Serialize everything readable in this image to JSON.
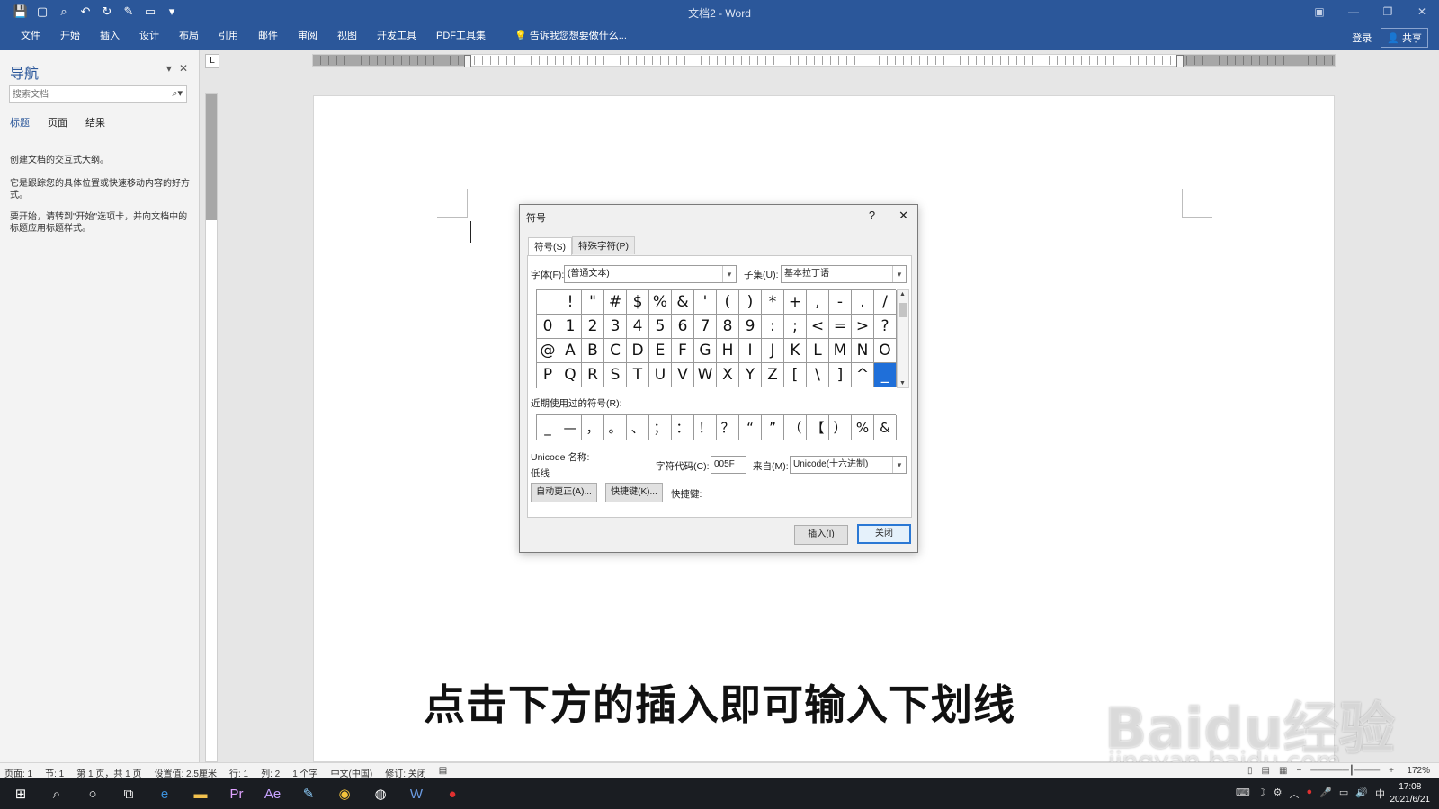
{
  "titlebar": {
    "title": "文档2 - Word",
    "qat_icons": [
      "save-icon",
      "new-document-icon",
      "print-preview-icon",
      "undo-icon",
      "redo-icon",
      "edit-icon",
      "open-icon",
      "customize-icon"
    ]
  },
  "ribbon": {
    "tabs": [
      "文件",
      "开始",
      "插入",
      "设计",
      "布局",
      "引用",
      "邮件",
      "审阅",
      "视图",
      "开发工具",
      "PDF工具集"
    ],
    "tell_me": "告诉我您想要做什么...",
    "login": "登录",
    "share": "共享"
  },
  "nav": {
    "title": "导航",
    "search_placeholder": "搜索文档",
    "tabs": [
      "标题",
      "页面",
      "结果"
    ],
    "hint1": "创建文档的交互式大纲。",
    "hint2": "它是跟踪您的具体位置或快速移动内容的好方式。",
    "hint3": "要开始，请转到\"开始\"选项卡，并向文档中的标题应用标题样式。"
  },
  "ruler": {
    "corner": "L"
  },
  "dialog": {
    "title": "符号",
    "help": "?",
    "close": "✕",
    "tabs": [
      "符号(S)",
      "特殊字符(P)"
    ],
    "font_label": "字体(F):",
    "font_value": "(普通文本)",
    "subset_label": "子集(U):",
    "subset_value": "基本拉丁语",
    "symbols": [
      " ",
      "!",
      "\"",
      "#",
      "$",
      "%",
      "&",
      "'",
      "(",
      ")",
      "*",
      "+",
      ",",
      "-",
      ".",
      "/",
      "0",
      "1",
      "2",
      "3",
      "4",
      "5",
      "6",
      "7",
      "8",
      "9",
      ":",
      ";",
      "<",
      "=",
      ">",
      "?",
      "@",
      "A",
      "B",
      "C",
      "D",
      "E",
      "F",
      "G",
      "H",
      "I",
      "J",
      "K",
      "L",
      "M",
      "N",
      "O",
      "P",
      "Q",
      "R",
      "S",
      "T",
      "U",
      "V",
      "W",
      "X",
      "Y",
      "Z",
      "[",
      "\\",
      "]",
      "^",
      "_"
    ],
    "selected_index": 63,
    "recent_label": "近期使用过的符号(R):",
    "recent": [
      "_",
      "—",
      "，",
      "。",
      "、",
      "；",
      "：",
      "！",
      "？",
      "“",
      "”",
      "（",
      "【",
      "）",
      "%",
      "&"
    ],
    "unicode_name_label": "Unicode 名称:",
    "unicode_name_value": "低线",
    "char_code_label": "字符代码(C):",
    "char_code_value": "005F",
    "from_label": "来自(M):",
    "from_value": "Unicode(十六进制)",
    "autocorrect_button": "自动更正(A)...",
    "shortcut_button": "快捷键(K)...",
    "shortcut_label": "快捷键:",
    "insert_button": "插入(I)",
    "close_button": "关闭"
  },
  "subtitle": "点击下方的插入即可输入下划线",
  "watermark": {
    "logo": "Baidu经验",
    "url": "jingyan.baidu.com"
  },
  "statusbar": {
    "items": [
      "页面: 1",
      "节: 1",
      "第 1 页，共 1 页",
      "设置值: 2.5厘米",
      "行: 1",
      "列: 2",
      "1 个字",
      "中文(中国)",
      "修订: 关闭"
    ],
    "zoom": "172%"
  },
  "taskbar": {
    "apps": [
      "windows-start-icon",
      "search-icon",
      "cortana-icon",
      "task-view-icon",
      "edge-icon",
      "file-explorer-icon",
      "premiere-icon",
      "after-effects-icon",
      "notepad-icon",
      "chrome-icon",
      "app-icon",
      "word-icon",
      "record-icon"
    ],
    "ime": "中",
    "time": "17:08",
    "date": "2021/6/21"
  },
  "colors": {
    "word_blue": "#2b579a",
    "selection_blue": "#1f6fd9",
    "taskbar": "#1a1d22"
  }
}
